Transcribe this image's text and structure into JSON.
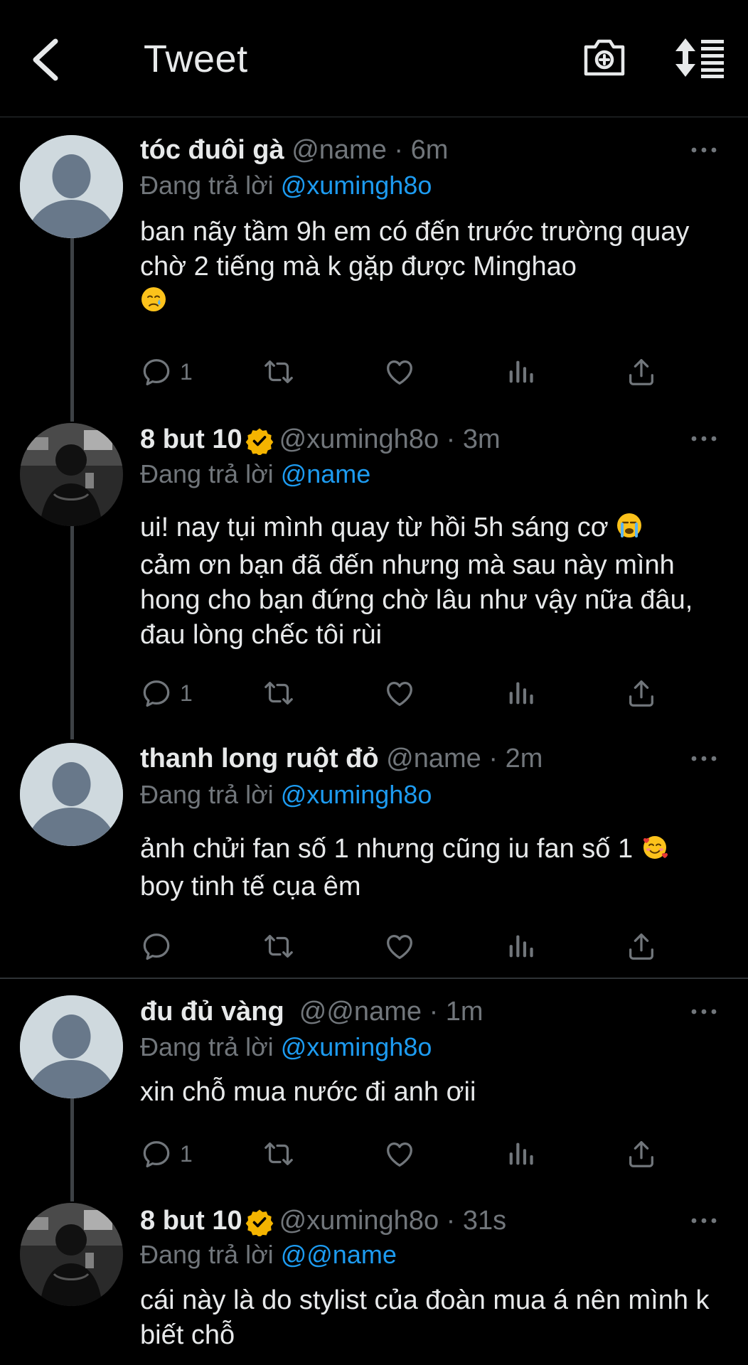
{
  "header": {
    "title": "Tweet",
    "back_icon": "chevron-left-icon",
    "camera_icon": "camera-plus-icon",
    "sort_icon": "sort-icon"
  },
  "colors": {
    "background": "#000000",
    "text": "#e7e9ea",
    "muted": "#71767b",
    "link": "#1d9bf0",
    "verified": "#f4b400"
  },
  "tweets": [
    {
      "display_name": "tóc đuôi gà",
      "handle": "@name",
      "time": "6m",
      "verified": false,
      "reply_prefix": "Đang trả lời",
      "reply_to": "@xumingh8o",
      "text": "ban nãy tầm 9h em có đến trước trường quay chờ 2 tiếng mà k gặp được Minghao",
      "emoji": "crying-face",
      "reply_count": "1"
    },
    {
      "display_name": "8 but 10",
      "handle": "@xumingh8o",
      "time": "3m",
      "verified": true,
      "reply_prefix": "Đang trả lời",
      "reply_to": "@name",
      "text": "ui! nay tụi mình quay từ hồi 5h sáng cơ",
      "text2": "cảm ơn bạn đã đến nhưng mà sau này mình hong cho bạn đứng chờ lâu như vậy nữa đâu, đau lòng chếc tôi rùi",
      "emoji": "loudly-crying-face",
      "reply_count": "1"
    },
    {
      "display_name": "thanh long ruột đỏ",
      "handle": "@name",
      "time": "2m",
      "verified": false,
      "reply_prefix": "Đang trả lời",
      "reply_to": "@xumingh8o",
      "text": "ảnh chửi fan số 1 nhưng cũng iu fan số 1",
      "text2": "boy tinh tế cụa êm",
      "emoji": "smiling-face-with-hearts",
      "reply_count": ""
    },
    {
      "display_name": "đu đủ vàng",
      "handle": "@@name",
      "time": "1m",
      "verified": false,
      "reply_prefix": "Đang trả lời",
      "reply_to": "@xumingh8o",
      "text": "xin chỗ mua nước đi anh ơii",
      "reply_count": "1"
    },
    {
      "display_name": "8 but 10",
      "handle": "@xumingh8o",
      "time": "31s",
      "verified": true,
      "reply_prefix": "Đang trả lời",
      "reply_to": "@@name",
      "text": "cái này là do stylist của đoàn mua á nên mình k biết chỗ"
    }
  ],
  "separator": "·"
}
